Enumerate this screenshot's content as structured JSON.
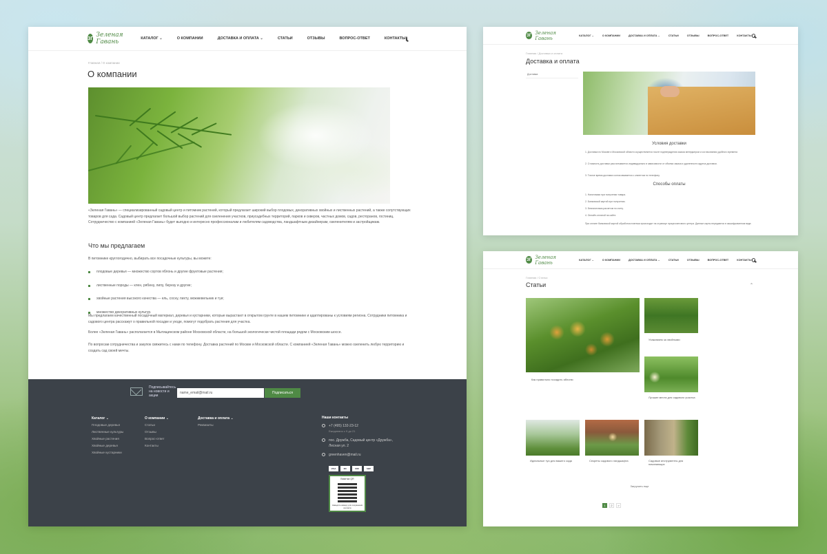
{
  "site": {
    "logo_text": "Зеленая Гавань",
    "logo_mark": "ЗГ"
  },
  "nav": [
    "КАТАЛОГ ⌄",
    "О КОМПАНИИ",
    "ДОСТАВКА И ОПЛАТА ⌄",
    "СТАТЬИ",
    "ОТЗЫВЫ",
    "ВОПРОС-ОТВЕТ",
    "КОНТАКТЫ"
  ],
  "about": {
    "breadcrumb": "Главная  /  О компании",
    "title": "О компании",
    "intro": "«Зеленая Гавань» — специализированный садовый центр и питомник растений, который предлагает широкий выбор плодовых, декоративных хвойных и лиственных растений, а также сопутствующих товаров для сада. Садовый центр предлагает большой выбор растений для озеленения участков, приусадебных территорий, парков и скверов, частных домов, садов, ресторанов, гостиниц. Сотрудничество с компанией «Зеленая Гавань» будет выгодно и интересно профессионалам и любителям садоводства, ландшафтным дизайнерам, озеленителям и застройщикам.",
    "offer_title": "Что мы предлагаем",
    "offer_lead": "В питомнике круглогодично, выбирать все посадочные культуры, вы можете:",
    "offer_items": [
      "плодовые деревья — множество сортов яблонь и другие фруктовые растения;",
      "лиственные породы — клен, рябину, липу, березу и другие;",
      "хвойные растения высокого качества — ель, сосну, пихту, можжевельник и туи;",
      "множество декоративных культур."
    ],
    "para2": "Мы предлагаем качественный посадочный материал, деревья и кустарники, которые вырастают в открытом грунте в нашем питомнике и адаптированы к условиям региона. Сотрудники питомника и садового центра расскажут о правильной посадке и уходе, помогут подобрать растения для участка.",
    "para3": "Более «Зеленая Гавань» располагается в Мытищинском районе Московской области, на большой экологически чистой площади рядом с Московским шоссе.",
    "para4": "По вопросам сотрудничества и закупок свяжитесь с нами по телефону. Доставка растений по Москве и Московской области. С компанией «Зеленая Гавань» можно озеленить любую территорию и создать сад своей мечты."
  },
  "subscribe": {
    "label": "Подписывайтесь на новости и акции",
    "placeholder": "name_email@mail.ru",
    "button": "Подписаться"
  },
  "footer": {
    "catalog_title": "Каталог ⌄",
    "catalog_items": [
      "Плодовые деревья",
      "Лиственные культуры",
      "Хвойные растения",
      "Хвойные деревья",
      "Хвойные кустарники"
    ],
    "company_title": "О компании ⌄",
    "company_items": [
      "Статьи",
      "Отзывы",
      "Вопрос-ответ",
      "Контакты"
    ],
    "delivery_title": "Доставка и оплата ⌄",
    "delivery_items": [
      "Реквизиты"
    ],
    "contacts_title": "Наши контакты",
    "phone": "+7 (495) 132-23-12",
    "hours": "Ежедневно с 9 до 21",
    "address": "пос. Дружба, Садовый центр «Дружба», Лесная ул. 2",
    "email": "greenhaven@mail.ru",
    "pay": [
      "VISA",
      "MC",
      "MIR",
      "SBP"
    ],
    "qr_title": "Визитка QR",
    "qr_note": "Наведите камеру для сохранения контакта"
  },
  "delivery": {
    "breadcrumb": "Главная  /  Доставка и оплата",
    "title": "Доставка и оплата",
    "side_item": "Доставка",
    "cond_title": "Условия доставки",
    "cond": [
      "1. Доставка по Москве и Московской области осуществляется после подтверждения заказа менеджером и согласования удобного времени.",
      "2. Стоимость доставки рассчитывается индивидуально в зависимости от объема заказа и удаленности адреса доставки.",
      "3. Точное время доставки согласовывается с клиентом по телефону."
    ],
    "pay_title": "Способы оплаты",
    "pay": [
      "1. Наличными при получении товара.",
      "2. Банковской картой при получении.",
      "3. Безналичным расчетом по счету.",
      "4. Онлайн-оплатой на сайте."
    ],
    "note": "При оплате банковской картой обработка платежа происходит на странице процессингового центра. Данные карты передаются в зашифрованном виде."
  },
  "articles": {
    "breadcrumb": "Главная  /  Статьи",
    "title": "Статьи",
    "items": [
      "Как правильно посадить яблоню",
      "Ухаживаем за хвойными",
      "Лучшие места для садового участка",
      "Идеальные туи для вашего сада",
      "Секреты садового ландшафта",
      "Садовые инструменты для начинающих"
    ],
    "load_more": "Загрузить еще",
    "pages": [
      "1",
      "2",
      ">"
    ]
  }
}
